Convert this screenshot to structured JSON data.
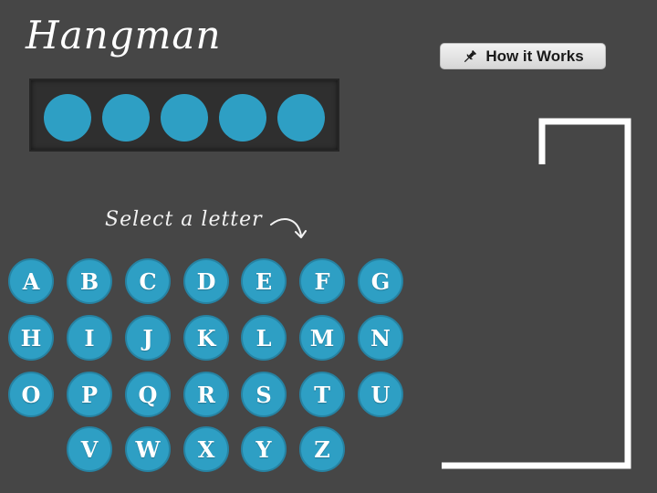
{
  "app": {
    "title": "Hangman"
  },
  "header": {
    "how_it_works_label": "How it Works",
    "how_it_works_icon": "pin-icon"
  },
  "word": {
    "length": 5,
    "revealed": [
      "",
      "",
      "",
      "",
      ""
    ]
  },
  "keyboard": {
    "prompt": "Select a letter",
    "rows": [
      [
        "A",
        "B",
        "C",
        "D",
        "E",
        "F",
        "G"
      ],
      [
        "H",
        "I",
        "J",
        "K",
        "L",
        "M",
        "N"
      ],
      [
        "O",
        "P",
        "Q",
        "R",
        "S",
        "T",
        "U"
      ],
      [
        "V",
        "W",
        "X",
        "Y",
        "Z"
      ]
    ]
  },
  "gallows": {
    "wrong_guesses": 0
  },
  "colors": {
    "background": "#464646",
    "accent": "#2e9fc4",
    "panel": "#2f2f2f",
    "text": "#ffffff"
  }
}
